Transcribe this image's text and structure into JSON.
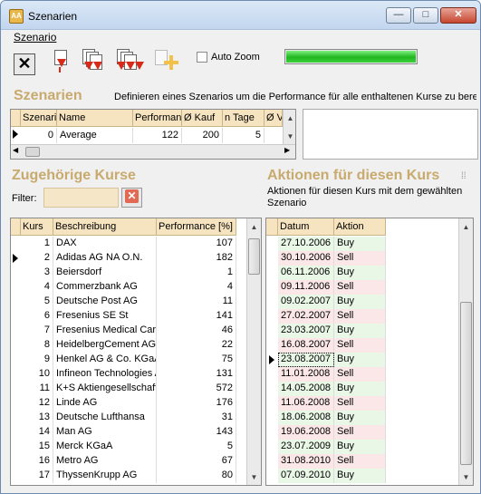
{
  "window": {
    "title": "Szenarien",
    "min": "—",
    "max": "□",
    "close": "✕"
  },
  "menu": {
    "items": [
      "Szenario"
    ]
  },
  "toolbar": {
    "buttons": [
      "cancel-icon",
      "run-single-icon",
      "run-multi-icon",
      "run-all-icon",
      "add-scenario-icon"
    ],
    "autozoom_label": "Auto Zoom",
    "autozoom_checked": false,
    "progress": 1.0,
    "progress_color": "#22b422"
  },
  "szenarien": {
    "title": "Szenarien",
    "description": "Definieren eines Szenarios um die Performance für alle enthaltenen Kurse zu berech",
    "columns": [
      "Szenario",
      "Name",
      "Performance",
      "Ø Kauf",
      "n Tage",
      "Ø V"
    ],
    "rows": [
      {
        "szenario": "0",
        "name": "Average",
        "performance": "122",
        "kauf": "200",
        "tage": "5",
        "v": ""
      }
    ]
  },
  "kurse": {
    "title": "Zugehörige Kurse",
    "filter_label": "Filter:",
    "filter_value": "",
    "columns": [
      "Kurs",
      "Beschreibung",
      "Performance [%]"
    ],
    "rows": [
      {
        "kurs": "1",
        "beschreibung": "DAX",
        "perf": "107"
      },
      {
        "kurs": "2",
        "beschreibung": "Adidas AG NA O.N.",
        "perf": "182"
      },
      {
        "kurs": "3",
        "beschreibung": "Beiersdorf",
        "perf": "1"
      },
      {
        "kurs": "4",
        "beschreibung": "Commerzbank AG",
        "perf": "4"
      },
      {
        "kurs": "5",
        "beschreibung": "Deutsche Post AG",
        "perf": "11"
      },
      {
        "kurs": "6",
        "beschreibung": "Fresenius SE St",
        "perf": "141"
      },
      {
        "kurs": "7",
        "beschreibung": "Fresenius Medical Care",
        "perf": "46"
      },
      {
        "kurs": "8",
        "beschreibung": "HeidelbergCement AG",
        "perf": "22"
      },
      {
        "kurs": "9",
        "beschreibung": "Henkel AG & Co. KGaA",
        "perf": "75"
      },
      {
        "kurs": "10",
        "beschreibung": "Infineon Technologies A",
        "perf": "131"
      },
      {
        "kurs": "11",
        "beschreibung": "K+S Aktiengesellschaft",
        "perf": "572"
      },
      {
        "kurs": "12",
        "beschreibung": "Linde AG",
        "perf": "176"
      },
      {
        "kurs": "13",
        "beschreibung": "Deutsche Lufthansa",
        "perf": "31"
      },
      {
        "kurs": "14",
        "beschreibung": "Man AG",
        "perf": "143"
      },
      {
        "kurs": "15",
        "beschreibung": "Merck KGaA",
        "perf": "5"
      },
      {
        "kurs": "16",
        "beschreibung": "Metro AG",
        "perf": "67"
      },
      {
        "kurs": "17",
        "beschreibung": "ThyssenKrupp AG",
        "perf": "80"
      }
    ],
    "selected_index": 1
  },
  "aktionen": {
    "title": "Aktionen für diesen Kurs",
    "description": "Aktionen für diesen Kurs mit dem gewählten Szenario",
    "columns": [
      "Datum",
      "Aktion"
    ],
    "rows": [
      {
        "datum": "27.10.2006",
        "aktion": "Buy"
      },
      {
        "datum": "30.10.2006",
        "aktion": "Sell"
      },
      {
        "datum": "06.11.2006",
        "aktion": "Buy"
      },
      {
        "datum": "09.11.2006",
        "aktion": "Sell"
      },
      {
        "datum": "09.02.2007",
        "aktion": "Buy"
      },
      {
        "datum": "27.02.2007",
        "aktion": "Sell"
      },
      {
        "datum": "23.03.2007",
        "aktion": "Buy"
      },
      {
        "datum": "16.08.2007",
        "aktion": "Sell"
      },
      {
        "datum": "23.08.2007",
        "aktion": "Buy"
      },
      {
        "datum": "11.01.2008",
        "aktion": "Sell"
      },
      {
        "datum": "14.05.2008",
        "aktion": "Buy"
      },
      {
        "datum": "11.06.2008",
        "aktion": "Sell"
      },
      {
        "datum": "18.06.2008",
        "aktion": "Buy"
      },
      {
        "datum": "19.06.2008",
        "aktion": "Sell"
      },
      {
        "datum": "23.07.2009",
        "aktion": "Buy"
      },
      {
        "datum": "31.08.2010",
        "aktion": "Sell"
      },
      {
        "datum": "07.09.2010",
        "aktion": "Buy"
      }
    ],
    "selected_index": 8,
    "buy_color": "#e9f8e6",
    "sell_color": "#fbe7e7"
  }
}
